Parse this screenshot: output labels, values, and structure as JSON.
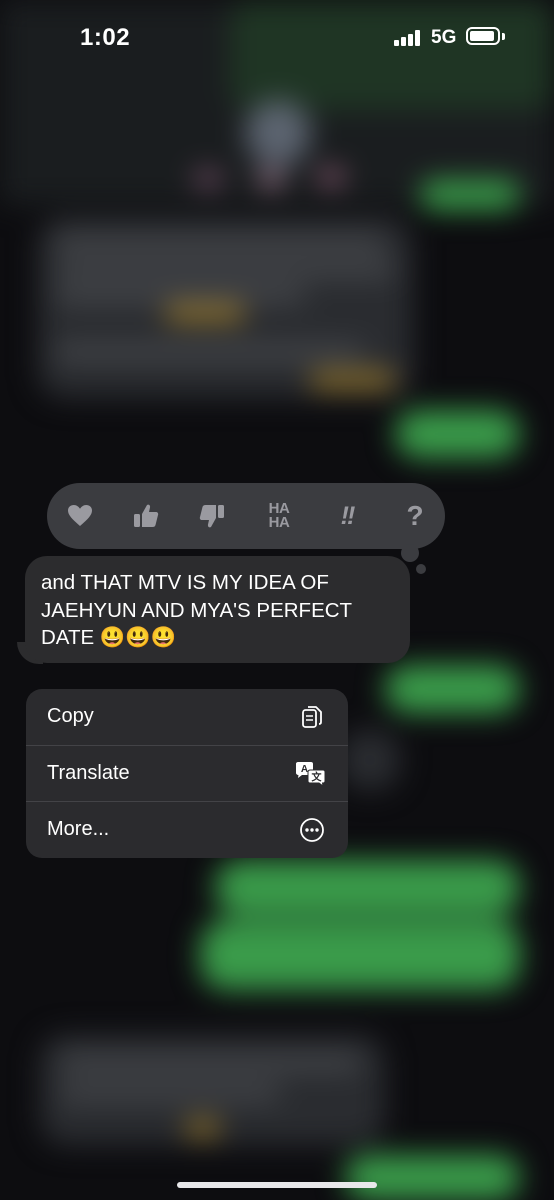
{
  "status_bar": {
    "time": "1:02",
    "network": "5G"
  },
  "tapback": {
    "reactions": [
      {
        "name": "heart",
        "icon": "heart-icon"
      },
      {
        "name": "thumbs-up",
        "icon": "thumbs-up-icon"
      },
      {
        "name": "thumbs-down",
        "icon": "thumbs-down-icon"
      },
      {
        "name": "haha",
        "icon": "haha-icon",
        "label_line1": "HA",
        "label_line2": "HA"
      },
      {
        "name": "emphasize",
        "icon": "double-exclamation-icon",
        "label": "!!"
      },
      {
        "name": "question",
        "icon": "question-mark-icon",
        "label": "?"
      }
    ]
  },
  "message": {
    "text": "and THAT MTV IS MY IDEA OF JAEHYUN AND MYA'S PERFECT DATE 😃😃😃"
  },
  "context_menu": {
    "items": [
      {
        "label": "Copy",
        "icon": "copy-icon"
      },
      {
        "label": "Translate",
        "icon": "translate-icon"
      },
      {
        "label": "More...",
        "icon": "more-ellipsis-icon"
      }
    ]
  },
  "colors": {
    "background": "#0d0d10",
    "bubble_gray": "#2c2c2e",
    "menu_bg": "#2b2b2e",
    "tapback_bg": "#3b3c40",
    "blurred_green": "#3a9b4a",
    "icon_gray": "#9a9aa0"
  }
}
